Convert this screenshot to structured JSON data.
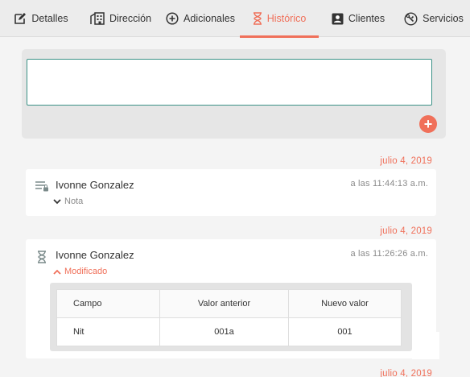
{
  "tabs": [
    {
      "label": "Detalles",
      "icon": "edit-icon"
    },
    {
      "label": "Dirección",
      "icon": "building-icon"
    },
    {
      "label": "Adicionales",
      "icon": "plus-circle-icon"
    },
    {
      "label": "Histórico",
      "icon": "hourglass-icon",
      "active": true
    },
    {
      "label": "Clientes",
      "icon": "contact-card-icon"
    },
    {
      "label": "Servicios",
      "icon": "tools-icon"
    }
  ],
  "composer": {
    "value": "",
    "add_label": "+"
  },
  "timeline": [
    {
      "date": "julio 4, 2019",
      "user": "Ivonne Gonzalez",
      "time": "a las 11:44:13 a.m.",
      "toggle": "Nota",
      "icon": "note-lines-icon"
    },
    {
      "date": "julio 4, 2019",
      "user": "Ivonne Gonzalez",
      "time": "a las 11:26:26 a.m.",
      "toggle": "Modificado",
      "icon": "hourglass-icon",
      "changes": {
        "headers": [
          "Campo",
          "Valor anterior",
          "Nuevo valor"
        ],
        "rows": [
          [
            "Nit",
            "001a",
            "001"
          ]
        ]
      }
    },
    {
      "date": "julio 4, 2019"
    }
  ],
  "colors": {
    "accent": "#f0705a",
    "focus": "#3b9186"
  }
}
